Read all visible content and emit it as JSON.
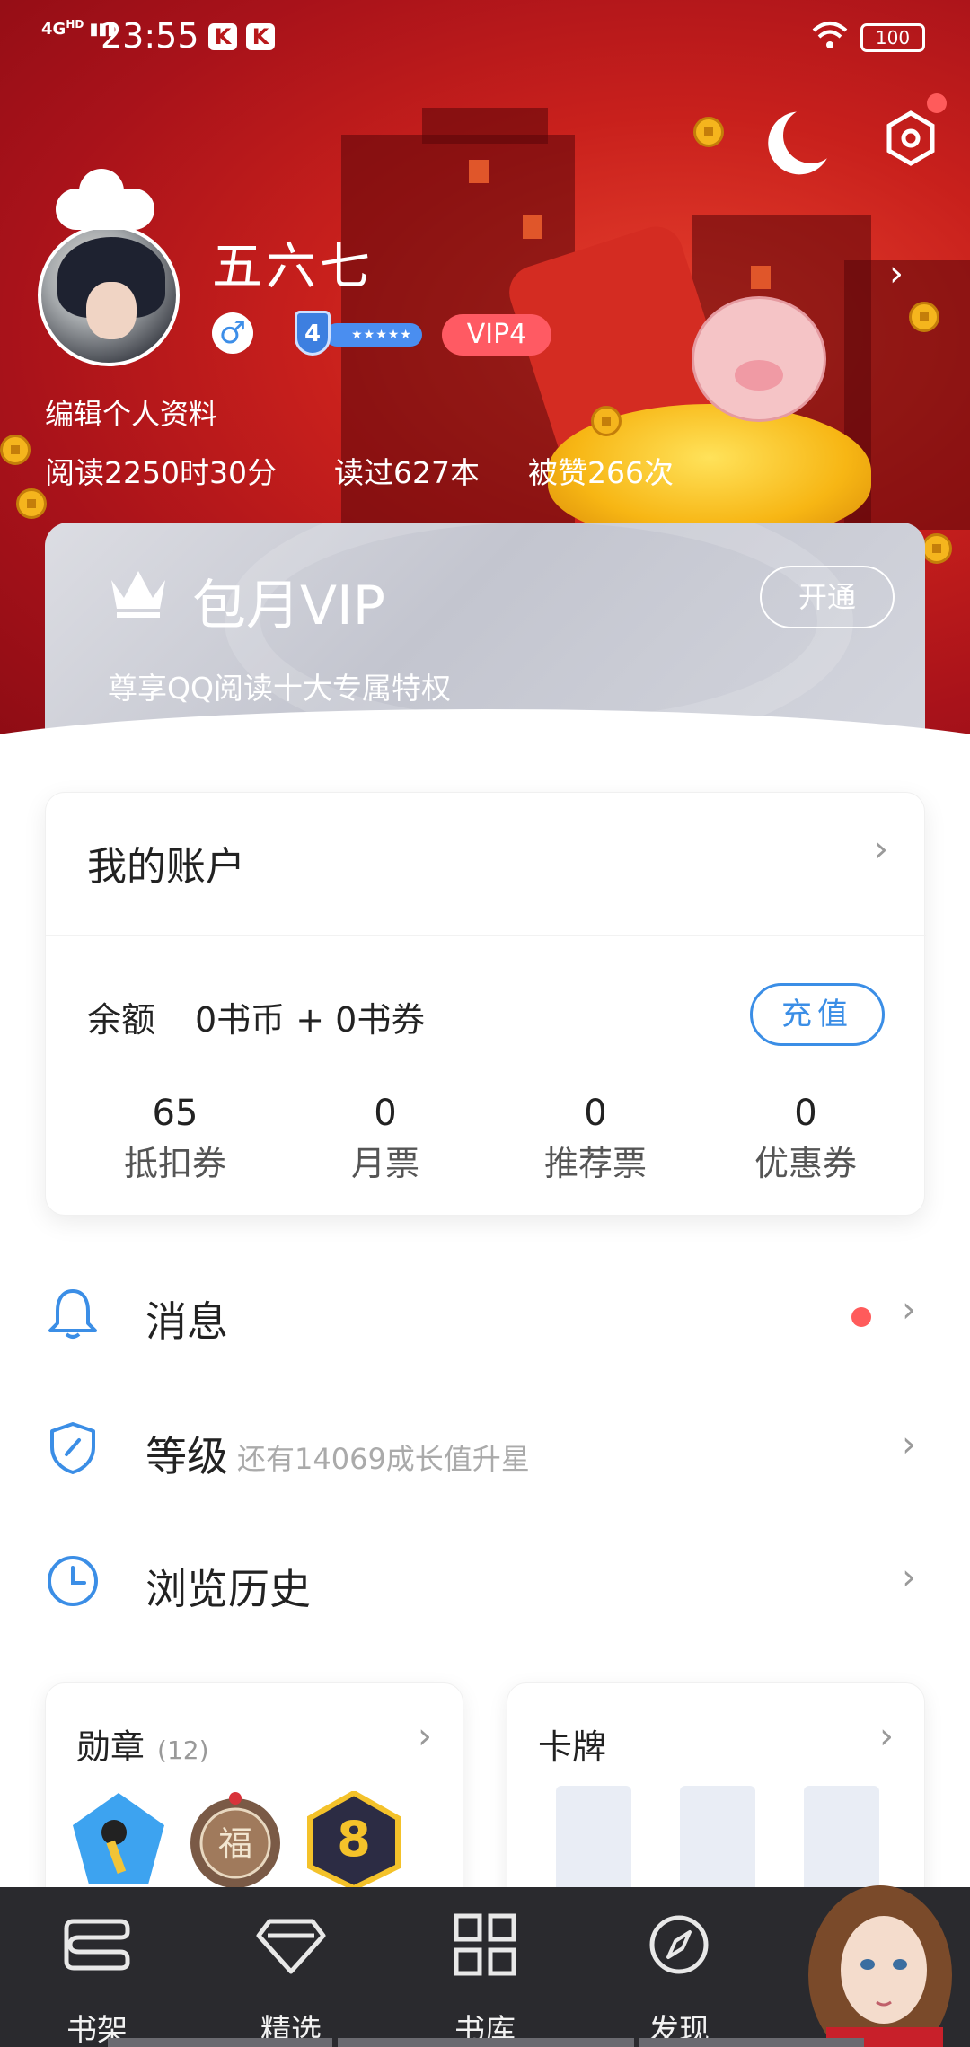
{
  "status_bar": {
    "network": "4G",
    "hd": "HD",
    "time": "23:55",
    "app_badge_1": "K",
    "app_badge_2": "K",
    "battery": "100"
  },
  "profile": {
    "username": "五六七",
    "gender_symbol": "♂",
    "level": "4",
    "level_stars": "★★★★★",
    "vip_badge": "VIP4",
    "edit_link": "编辑个人资料",
    "read_time": "阅读2250时30分",
    "books_read": "读过627本",
    "likes": "被赞266次"
  },
  "vip_card": {
    "title": "包月VIP",
    "description": "尊享QQ阅读十大专属特权",
    "open_button": "开通"
  },
  "account": {
    "title": "我的账户",
    "balance_label": "余额",
    "balance_value": "0书币 + 0书券",
    "recharge_button": "充值",
    "tickets": [
      {
        "value": "65",
        "label": "抵扣券"
      },
      {
        "value": "0",
        "label": "月票"
      },
      {
        "value": "0",
        "label": "推荐票"
      },
      {
        "value": "0",
        "label": "优惠券"
      }
    ]
  },
  "menu": {
    "messages": "消息",
    "level": "等级",
    "level_hint": "还有14069成长值升星",
    "history": "浏览历史"
  },
  "panels": {
    "medals_title": "勋章",
    "medals_count": "(12)",
    "medal_8_label": "8",
    "cards_title": "卡牌"
  },
  "nav": {
    "tabs": [
      {
        "label": "书架",
        "icon": "bookshelf-icon"
      },
      {
        "label": "精选",
        "icon": "diamond-icon"
      },
      {
        "label": "书库",
        "icon": "grid-icon"
      },
      {
        "label": "发现",
        "icon": "compass-icon"
      }
    ]
  },
  "colors": {
    "header_red": "#c8201c",
    "accent_blue": "#3b8ee6",
    "vip_pink": "#ff5a63",
    "nav_dark": "#2a2a2e",
    "unread_dot": "#ff5b5b"
  }
}
